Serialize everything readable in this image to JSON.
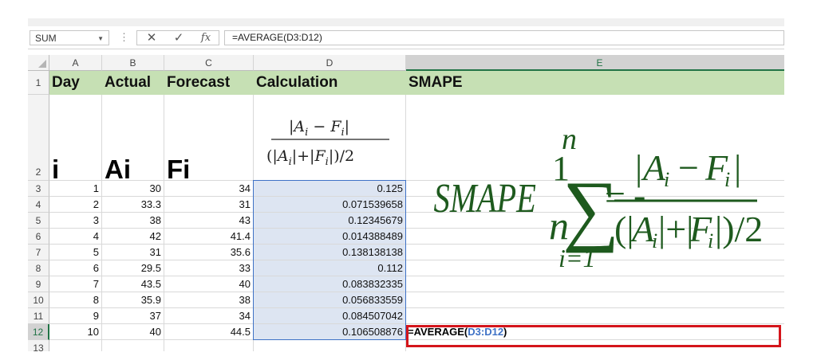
{
  "formula_bar": {
    "name_box": "SUM",
    "cancel_glyph": "✕",
    "enter_glyph": "✓",
    "fx_label": "fx",
    "formula": "=AVERAGE(D3:D12)"
  },
  "columns": [
    "A",
    "B",
    "C",
    "D",
    "E"
  ],
  "selected_column": "E",
  "row_numbers": [
    "1",
    "2",
    "3",
    "4",
    "5",
    "6",
    "7",
    "8",
    "9",
    "10",
    "11",
    "12",
    "13"
  ],
  "selected_row": "12",
  "header_row": {
    "a": "Day",
    "b": "Actual",
    "c": "Forecast",
    "d": "Calculation",
    "e": "SMAPE"
  },
  "symbol_row": {
    "a": "i",
    "b": "Ai",
    "c": "Fi"
  },
  "data_rows": [
    {
      "day": "1",
      "actual": "30",
      "forecast": "34",
      "calc": "0.125"
    },
    {
      "day": "2",
      "actual": "33.3",
      "forecast": "31",
      "calc": "0.071539658"
    },
    {
      "day": "3",
      "actual": "38",
      "forecast": "43",
      "calc": "0.12345679"
    },
    {
      "day": "4",
      "actual": "42",
      "forecast": "41.4",
      "calc": "0.014388489"
    },
    {
      "day": "5",
      "actual": "31",
      "forecast": "35.6",
      "calc": "0.138138138"
    },
    {
      "day": "6",
      "actual": "29.5",
      "forecast": "33",
      "calc": "0.112"
    },
    {
      "day": "7",
      "actual": "43.5",
      "forecast": "40",
      "calc": "0.083832335"
    },
    {
      "day": "8",
      "actual": "35.9",
      "forecast": "38",
      "calc": "0.056833559"
    },
    {
      "day": "9",
      "actual": "37",
      "forecast": "34",
      "calc": "0.084507042"
    },
    {
      "day": "10",
      "actual": "40",
      "forecast": "44.5",
      "calc": "0.106508876"
    }
  ],
  "active_cell": {
    "prefix": "=AVERAGE(",
    "range": "D3:D12",
    "suffix": ")"
  },
  "colors": {
    "header_fill": "#c6e0b4",
    "formula_green": "#1e5a1e",
    "highlight_red": "#d4151b",
    "range_blue": "#3f72c6"
  }
}
